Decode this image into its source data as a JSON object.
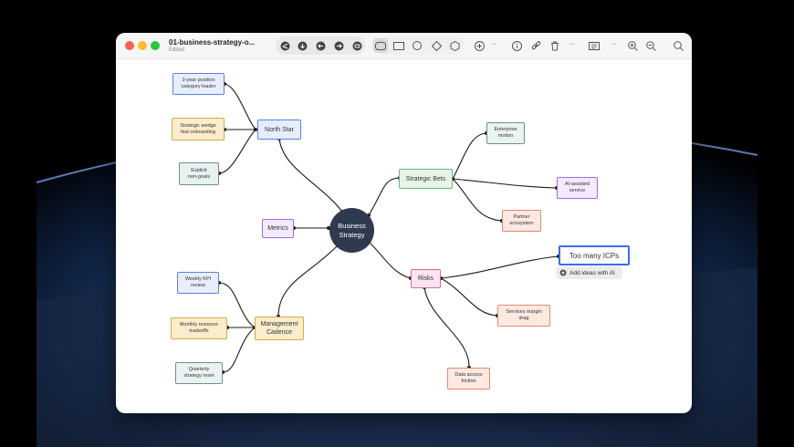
{
  "window": {
    "title": "01-business-strategy-o...",
    "subtitle": "Edited"
  },
  "toolbar": {
    "icons": [
      "share-icon",
      "download-icon",
      "arrow-left-icon",
      "arrow-right-icon",
      "refresh-icon",
      "rounded-rect-shape-icon",
      "rect-shape-icon",
      "circle-shape-icon",
      "diamond-shape-icon",
      "hexagon-shape-icon",
      "add-node-icon",
      "info-icon",
      "link-icon",
      "trash-icon",
      "outline-view-icon",
      "zoom-in-icon",
      "zoom-out-icon",
      "search-icon"
    ]
  },
  "mindmap": {
    "root": "Business\nStrategy",
    "north_star": {
      "label": "North Star",
      "children": [
        "3-year position\ncategory leader",
        "Strategic wedge\nfast onboarding",
        "Explicit\nnon-goals"
      ]
    },
    "strategic_bets": {
      "label": "Strategic Bets",
      "children": [
        "Enterprise\nmotion",
        "AI-assisted\nservice",
        "Partner\necosystem"
      ]
    },
    "metrics": {
      "label": "Metrics"
    },
    "risks": {
      "label": "Risks",
      "children": [
        "Too many ICPs",
        "Services margin\ndrag",
        "Data access\nfriction"
      ]
    },
    "cadence": {
      "label": "Management\nCadence",
      "children": [
        "Weekly KPI\nreview",
        "Monthly resource\ntradeoffs",
        "Quarterly\nstrategy reset"
      ]
    },
    "ai_button": "Add ideas with AI"
  },
  "colors": {
    "blue": "#5b7fe8",
    "orange": "#d6a94a",
    "teal": "#6f8f8f",
    "green": "#6bb77a",
    "purple": "#a06be0",
    "pink": "#d86a9a",
    "salmon": "#e08a70",
    "root": "#2e3b4e"
  }
}
